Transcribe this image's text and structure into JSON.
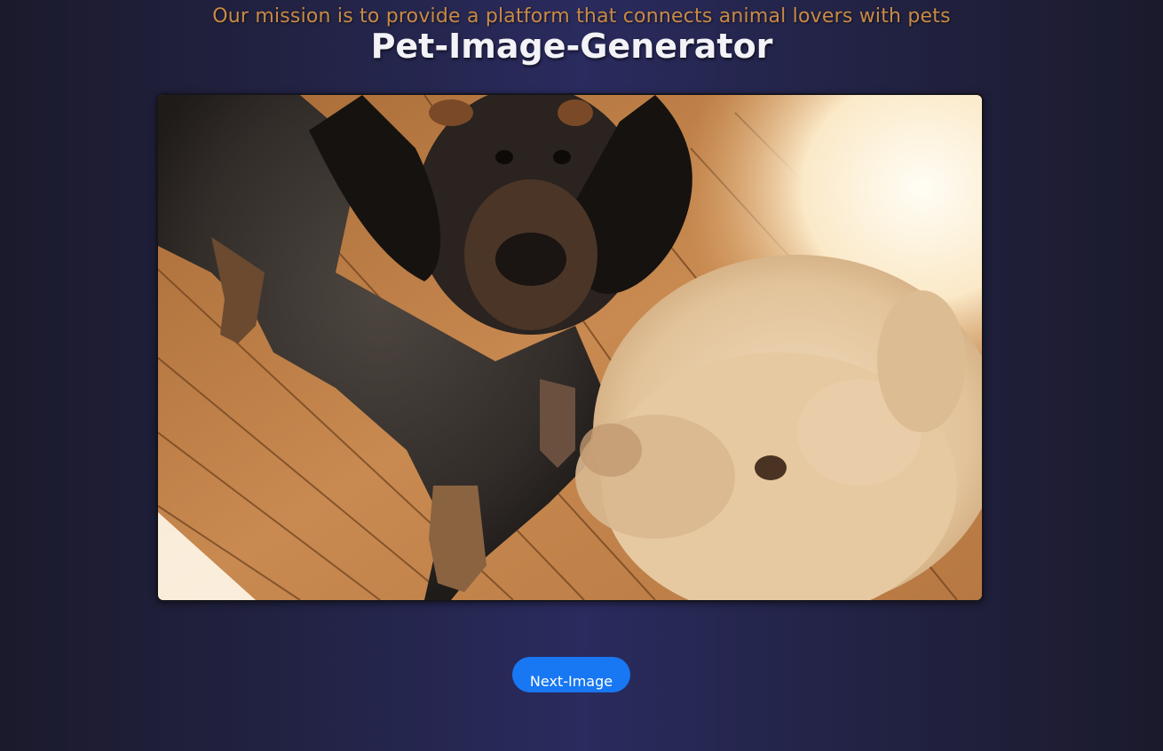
{
  "header": {
    "mission": "Our mission is to provide a platform that connects animal lovers with pets",
    "title": "Pet-Image-Generator"
  },
  "main": {
    "image_alt": "pet-photo",
    "next_button_label": "Next-Image"
  },
  "colors": {
    "mission_text": "#c98a45",
    "title_text": "#f3f2f6",
    "button_bg": "#1877f2",
    "page_bg": "#232448"
  }
}
